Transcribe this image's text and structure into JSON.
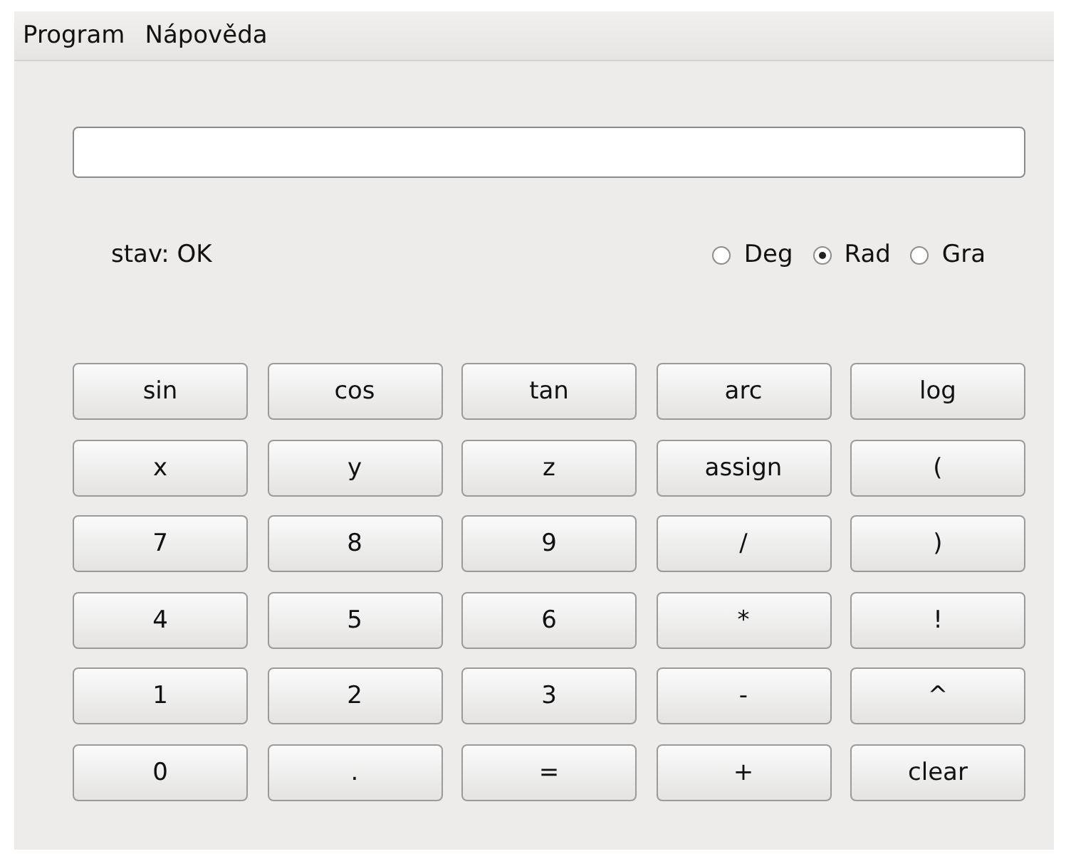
{
  "menu": [
    "Program",
    "Nápověda"
  ],
  "status": "stav: OK",
  "angle_modes": [
    {
      "label": "Deg",
      "selected": false
    },
    {
      "label": "Rad",
      "selected": true
    },
    {
      "label": "Gra",
      "selected": false
    }
  ],
  "buttons": [
    "sin",
    "cos",
    "tan",
    "arc",
    "log",
    "x",
    "y",
    "z",
    "assign",
    "(",
    "7",
    "8",
    "9",
    "/",
    ")",
    "4",
    "5",
    "6",
    "*",
    "!",
    "1",
    "2",
    "3",
    "-",
    "^",
    "0",
    ".",
    "=",
    "+",
    "clear"
  ]
}
